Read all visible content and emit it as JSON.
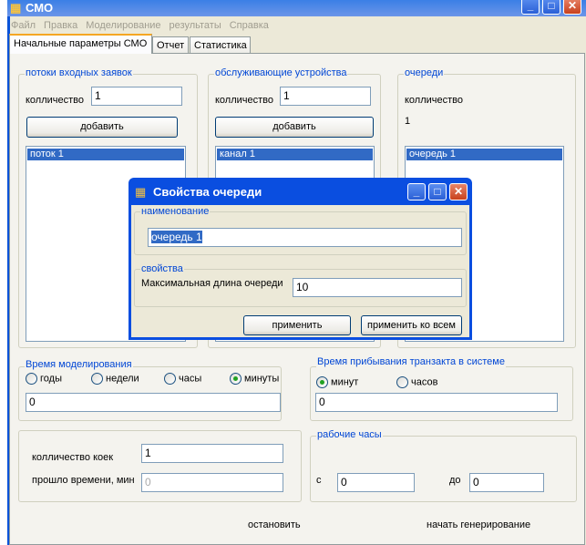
{
  "window": {
    "title": "СМО"
  },
  "menu": [
    "Файл",
    "Правка",
    "Моделирование",
    "результаты",
    "Справка"
  ],
  "tabs": [
    "Начальные параметры СМО",
    "Отчет",
    "Статистика"
  ],
  "streams": {
    "title": "потоки входных заявок",
    "count_label": "колличество",
    "count": "1",
    "add": "добавить",
    "items": [
      "поток 1"
    ]
  },
  "servers": {
    "title": "обслуживающие устройства",
    "count_label": "колличество",
    "count": "1",
    "add": "добавить",
    "items": [
      "канал 1"
    ]
  },
  "queues": {
    "title": "очереди",
    "count_label": "колличество",
    "count": "1",
    "items": [
      "очередь 1"
    ]
  },
  "dialog": {
    "title": "Свойства очереди",
    "name_group": "наименование",
    "name_value": "очередь 1",
    "props_group": "свойства",
    "max_len_label": "Максимальная длина очереди",
    "max_len": "10",
    "apply": "применить",
    "apply_all": "применить ко всем"
  },
  "sim_time": {
    "title": "Время моделирования",
    "options": [
      "годы",
      "недели",
      "часы",
      "минуты"
    ],
    "selected": "минуты",
    "value": "0"
  },
  "arrival": {
    "title": "Время прибывания транзакта в системе",
    "options": [
      "минут",
      "часов"
    ],
    "selected": "минут",
    "value": "0"
  },
  "beds": {
    "count_label": "колличество коек",
    "count": "1",
    "elapsed_label": "прошло времени, мин",
    "elapsed": "0"
  },
  "work_hours": {
    "title": "рабочие часы",
    "from_label": "с",
    "from": "0",
    "to_label": "до",
    "to": "0"
  },
  "actions": {
    "stop": "остановить",
    "start": "начать генерирование"
  }
}
